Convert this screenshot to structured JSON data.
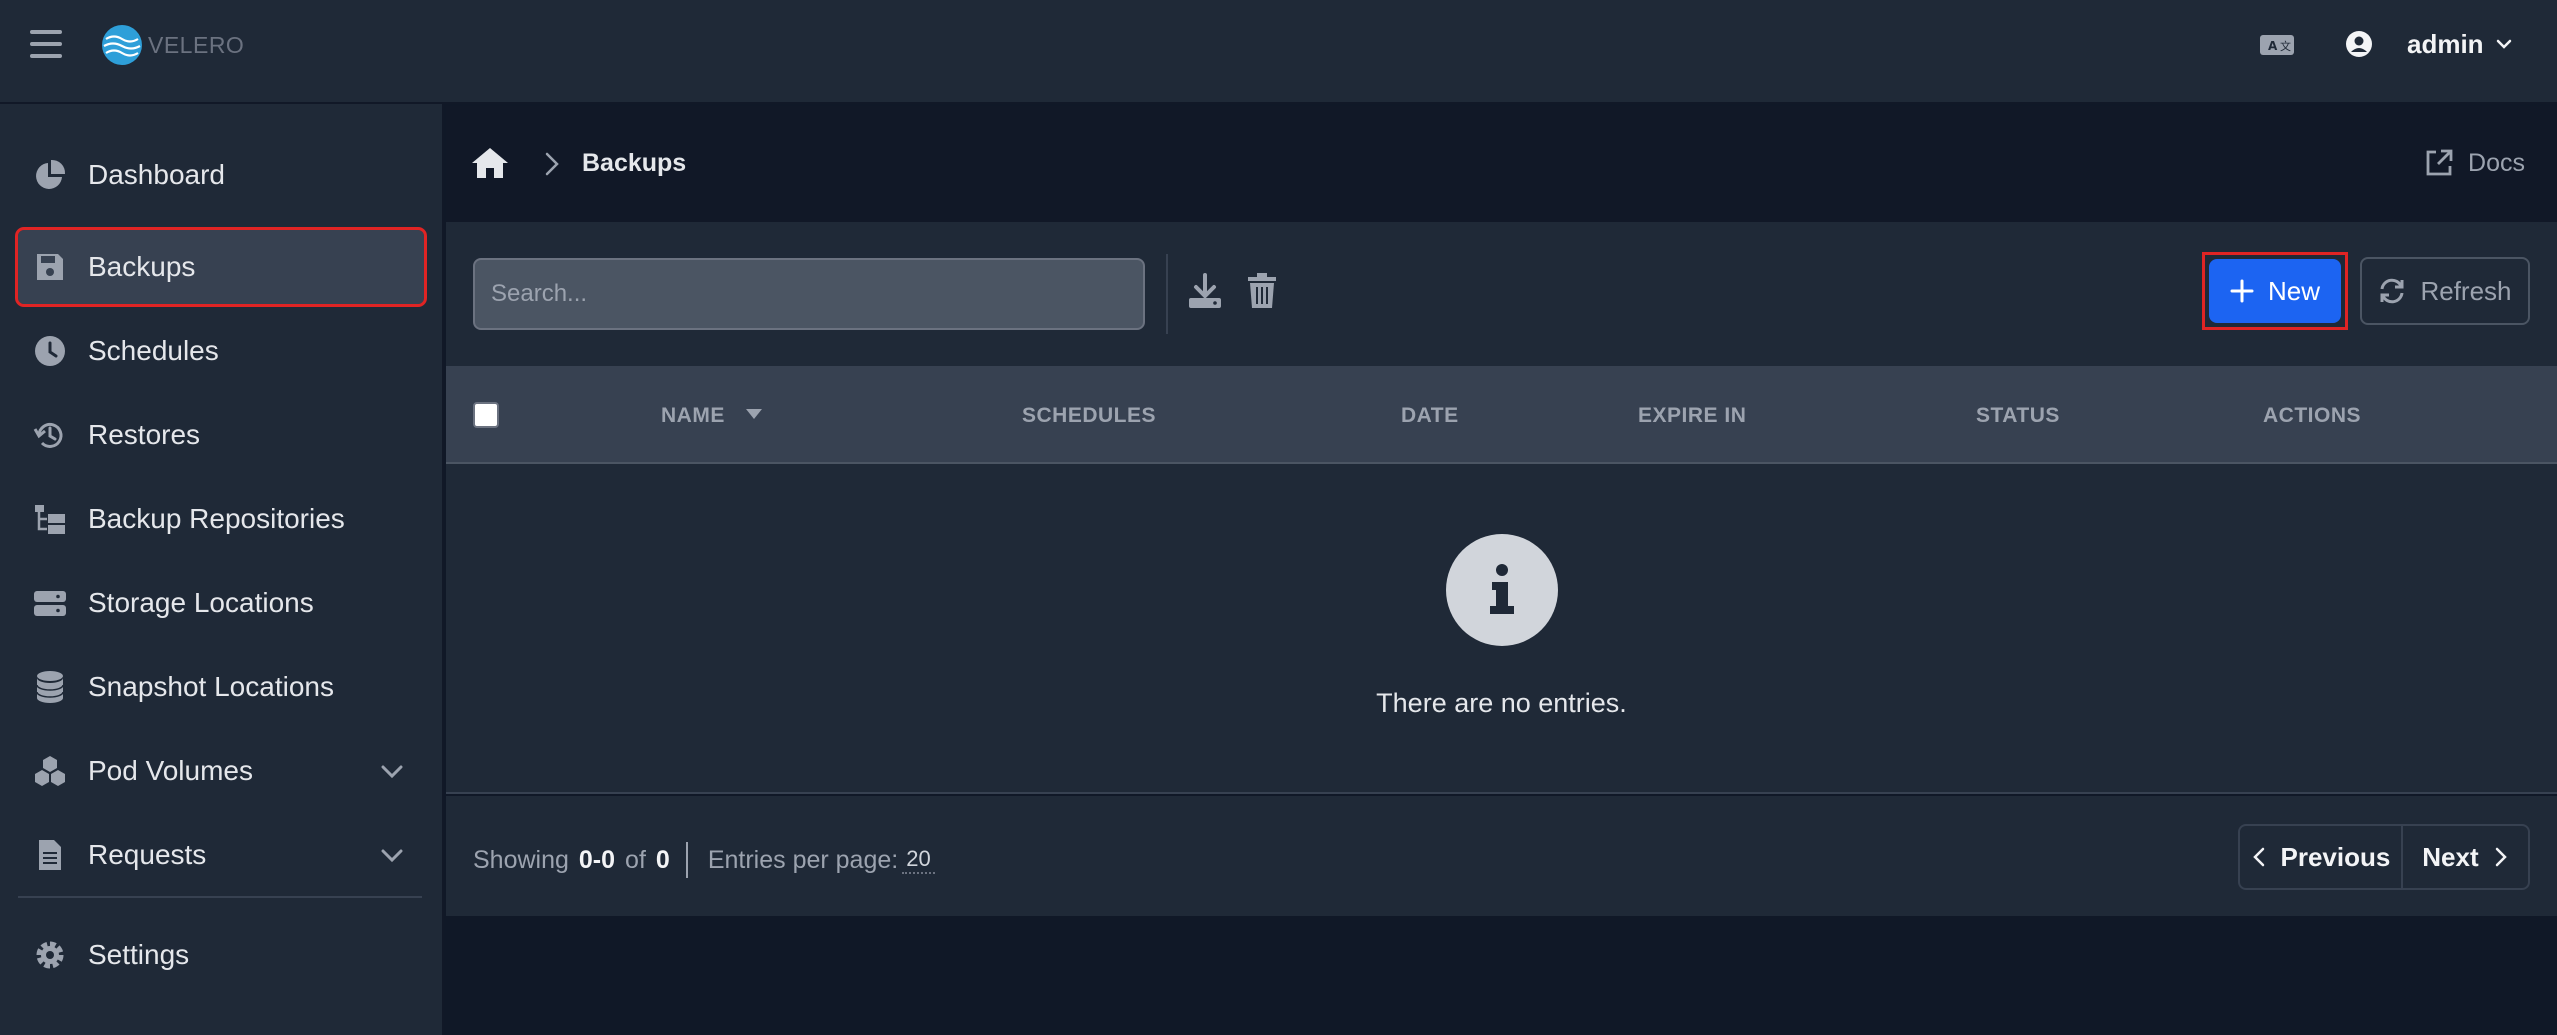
{
  "app": {
    "logo_text": "VELERO",
    "accent": "#1c64f2",
    "highlight": "#e02424"
  },
  "header": {
    "user_name": "admin"
  },
  "sidebar": {
    "items": [
      {
        "label": "Dashboard",
        "icon": "pie-chart-icon"
      },
      {
        "label": "Backups",
        "icon": "floppy-disk-icon",
        "active": true
      },
      {
        "label": "Schedules",
        "icon": "clock-icon"
      },
      {
        "label": "Restores",
        "icon": "history-icon"
      },
      {
        "label": "Backup Repositories",
        "icon": "folder-tree-icon"
      },
      {
        "label": "Storage Locations",
        "icon": "server-icon"
      },
      {
        "label": "Snapshot Locations",
        "icon": "database-icon"
      },
      {
        "label": "Pod Volumes",
        "icon": "cubes-icon",
        "expandable": true
      },
      {
        "label": "Requests",
        "icon": "file-icon",
        "expandable": true
      },
      {
        "label": "Settings",
        "icon": "gear-icon"
      }
    ]
  },
  "breadcrumb": {
    "current": "Backups",
    "docs_label": "Docs"
  },
  "toolbar": {
    "search_placeholder": "Search...",
    "new_label": "New",
    "refresh_label": "Refresh"
  },
  "table": {
    "columns": [
      "NAME",
      "SCHEDULES",
      "DATE",
      "EXPIRE IN",
      "STATUS",
      "ACTIONS"
    ],
    "empty_message": "There are no entries."
  },
  "footer": {
    "showing_label": "Showing",
    "range": "0-0",
    "of_label": "of",
    "total": "0",
    "per_page_label": "Entries per page:",
    "per_page_value": "20",
    "previous_label": "Previous",
    "next_label": "Next"
  }
}
